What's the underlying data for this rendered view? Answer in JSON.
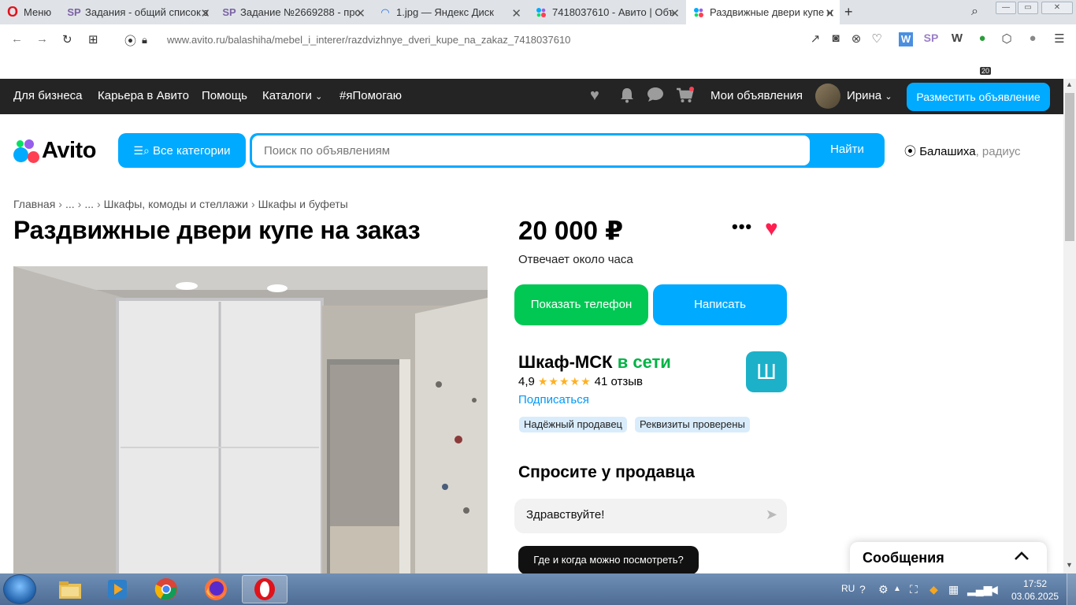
{
  "browser": {
    "menu_label": "Меню",
    "tabs": [
      {
        "title": "Задания - общий список з",
        "icon": "sp-icon"
      },
      {
        "title": "Задание №2669288 - про",
        "icon": "sp-icon"
      },
      {
        "title": "1.jpg — Яндекс Диск",
        "icon": "yandex-disk-icon"
      },
      {
        "title": "7418037610 - Авито | Объ",
        "icon": "avito-icon"
      },
      {
        "title": "Раздвижные двери купе н",
        "icon": "avito-icon",
        "active": true
      }
    ],
    "url_domain": "www.avito.ru",
    "url_path": "/balashiha/mebel_i_interer/razdvizhnye_dveri_kupe_na_zakaz_7418037610",
    "extension_badge": "20"
  },
  "avito_top": {
    "links": [
      "Для бизнеса",
      "Карьера в Авито",
      "Помощь",
      "Каталоги",
      "#яПомогаю"
    ],
    "my_ads": "Мои объявления",
    "user_name": "Ирина",
    "post_button": "Разместить объявление"
  },
  "search": {
    "logo_text": "Avito",
    "all_categories": "Все категории",
    "placeholder": "Поиск по объявлениям",
    "find_button": "Найти",
    "city": "Балашиха",
    "radius_label": ", радиус"
  },
  "breadcrumb": [
    "Главная",
    "...",
    "...",
    "Шкафы, комоды и стеллажи",
    "Шкафы и буфеты"
  ],
  "listing": {
    "title": "Раздвижные двери купе на заказ",
    "price": "20 000 ₽",
    "reply_time": "Отвечает около часа",
    "show_phone": "Показать телефон",
    "write": "Написать"
  },
  "seller": {
    "name": "Шкаф-МСК",
    "status": "в сети",
    "logo_letter": "Ш",
    "rating": "4,9",
    "reviews": "41 отзыв",
    "subscribe": "Подписаться",
    "badges": [
      "Надёжный продавец",
      "Реквизиты проверены"
    ]
  },
  "ask": {
    "title": "Спросите у продавца",
    "message": "Здравствуйте!",
    "quick_question": "Где и когда можно посмотреть?"
  },
  "messages_panel": {
    "label": "Сообщения"
  },
  "taskbar": {
    "language": "RU",
    "time": "17:52",
    "date": "03.06.2025"
  },
  "colors": {
    "accent_blue": "#00aaff",
    "green": "#00c853",
    "favorite_red": "#ff1e4f",
    "dark_bar": "#242424"
  }
}
